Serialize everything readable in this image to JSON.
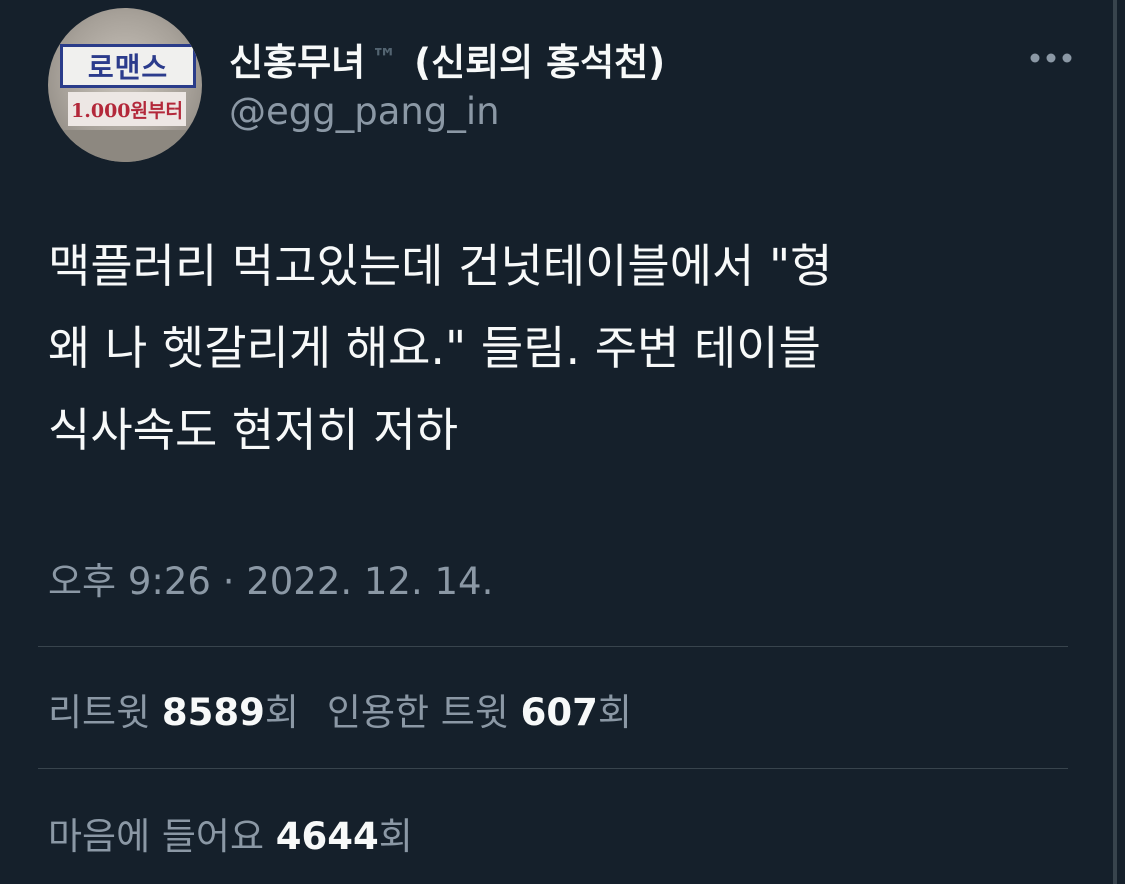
{
  "user": {
    "display_name": "신홍무녀",
    "badge": "™",
    "display_name_suffix": "(신뢰의 홍석천)",
    "handle": "@egg_pang_in",
    "avatar": {
      "sign_top": "로맨스",
      "sign_bottom": "1.000원부터"
    }
  },
  "tweet": {
    "text": "맥플러리 먹고있는데 건넛테이블에서 \"형\n왜 나 헷갈리게 해요.\" 들림. 주변 테이블\n식사속도 현저히 저하",
    "timestamp": "오후 9:26 · 2022. 12. 14."
  },
  "stats": {
    "retweets_label": "리트윗 ",
    "retweets_count": "8589",
    "retweets_suffix": "회",
    "quotes_label": "인용한 트윗 ",
    "quotes_count": "607",
    "quotes_suffix": "회",
    "likes_label": "마음에 들어요 ",
    "likes_count": "4644",
    "likes_suffix": "회"
  },
  "icons": {
    "more": "more-horizontal-icon"
  },
  "colors": {
    "background": "#15202b",
    "text_primary": "#f7f9f9",
    "text_secondary": "#8b98a5",
    "divider": "#38444d"
  }
}
